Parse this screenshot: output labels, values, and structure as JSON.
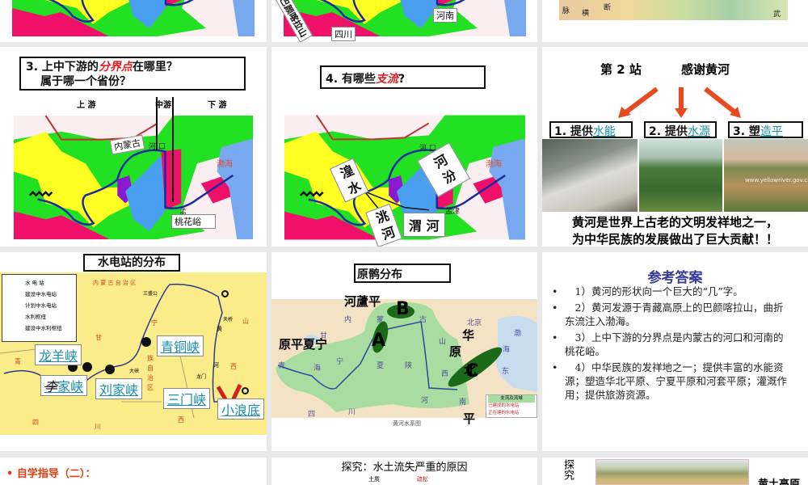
{
  "slides_row1": {
    "label_sichuan": "四川",
    "label_henan": "河南",
    "label_bayan": "巴颜喀拉山",
    "map_labels": [
      "脉",
      "横",
      "断",
      "武"
    ]
  },
  "slide_q3": {
    "title_prefix": "3. 上中下游的",
    "title_red": "分界点",
    "title_suffix": "在哪里？",
    "title_line2": "属于哪一个省份？",
    "upper": "上 游",
    "middle": "中游",
    "lower": "下 游",
    "inner_mongolia": "内蒙古",
    "hekou": "河 口",
    "bohai": "渤海",
    "meng": "孟",
    "taohuayu": "桃花峪"
  },
  "slide_q4": {
    "title_prefix": "4. 有哪些",
    "title_red": "支流",
    "title_suffix": "?",
    "hekou": "河 口",
    "bohai": "渤海",
    "mengjin": "孟津",
    "huangshui": "湟 水",
    "fenhe": "河 汾",
    "taohe": "洮 河",
    "weihe": "渭 河"
  },
  "slide_station": {
    "station": "第 2 站",
    "title": "感谢黄河",
    "box1_prefix": "1. 提供",
    "box1_link": "水能",
    "box2_prefix": "2. 提供",
    "box2_link": "水源",
    "box3_prefix": "3. 塑",
    "box3_link": "造平",
    "summary_line1": "黄河是世界上古老的文明发祥地之一，",
    "summary_line2": "为中华民族的发展做出了巨大贡献！！",
    "photo_watermark": "www.yellowriver.gov.cn"
  },
  "slide_hydro": {
    "title": "水电站的分布",
    "legend": [
      "水 电 站",
      "建设中水电站",
      "计划中水电站",
      "水利枢纽",
      "建设中水利枢纽"
    ],
    "map_labels": {
      "inner_mongolia": "内 蒙 古 自 治 区",
      "sanshenggong": "三盛公",
      "tianqiao": "天桥",
      "longmen": "龙门",
      "daxia": "大峡",
      "gan": "甘",
      "qing": "青",
      "si": "四",
      "chuan": "川",
      "shan": "山",
      "xi": "西",
      "xi2": "西",
      "huang": "黄",
      "he": "河",
      "ning": "宁",
      "zu": "族",
      "zi": "自",
      "zhi": "治",
      "qu": "区"
    },
    "stations": {
      "longyangxia": "龙羊峡",
      "lijiaxia_strike": "李",
      "lijiaxia": "家峡",
      "liujiaxia": "刘家峡",
      "qingtongxia": "青铜峡",
      "sanmenxia": "三门峡",
      "xiaolangdi": "小浪底"
    }
  },
  "slide_plain": {
    "title": "原鹘分布",
    "hetao": "河蘆平",
    "ningxia": "原平夏宁",
    "hua": "华",
    "yuan": "原",
    "bei": "北",
    "ping": "平",
    "a": "A",
    "b": "B",
    "c": "C",
    "caption": "黄河水系图",
    "legend": [
      "支流及流域",
      "已建成的水电站",
      "正在建的水电站"
    ],
    "map_labels": [
      "内",
      "蒙",
      "古",
      "甘",
      "青",
      "海",
      "宁",
      "夏",
      "陕",
      "山",
      "西",
      "河",
      "南",
      "北京",
      "东",
      "四",
      "川",
      "渤",
      "海"
    ]
  },
  "slide_answer": {
    "title": "参考答案",
    "items": [
      "　1）黄河的形状向一个巨大的“几”字。",
      "　2）黄河发源于青藏高原上的巴颜喀拉山，曲折东流注入渤海。",
      "　3）上中下游的分界点是内蒙古的河口和河南的桃花峪。",
      "　4）中华民族的发祥地之一；提供丰富的水能资源；塑造华北平原、宁夏平原和河套平原；灌溉作用；提供旅游资源。"
    ]
  },
  "slides_row4": {
    "guide": "• 自学指导（二）：",
    "explore_title": "探究：水土流失严重的原因",
    "soil": "土质",
    "loose": "疏松",
    "vertical": "探究",
    "loess": "黄土高原"
  },
  "colors": {
    "accent_red": "#e02020",
    "link": "#1a8fa8",
    "answer_title": "#3a3a9a"
  }
}
